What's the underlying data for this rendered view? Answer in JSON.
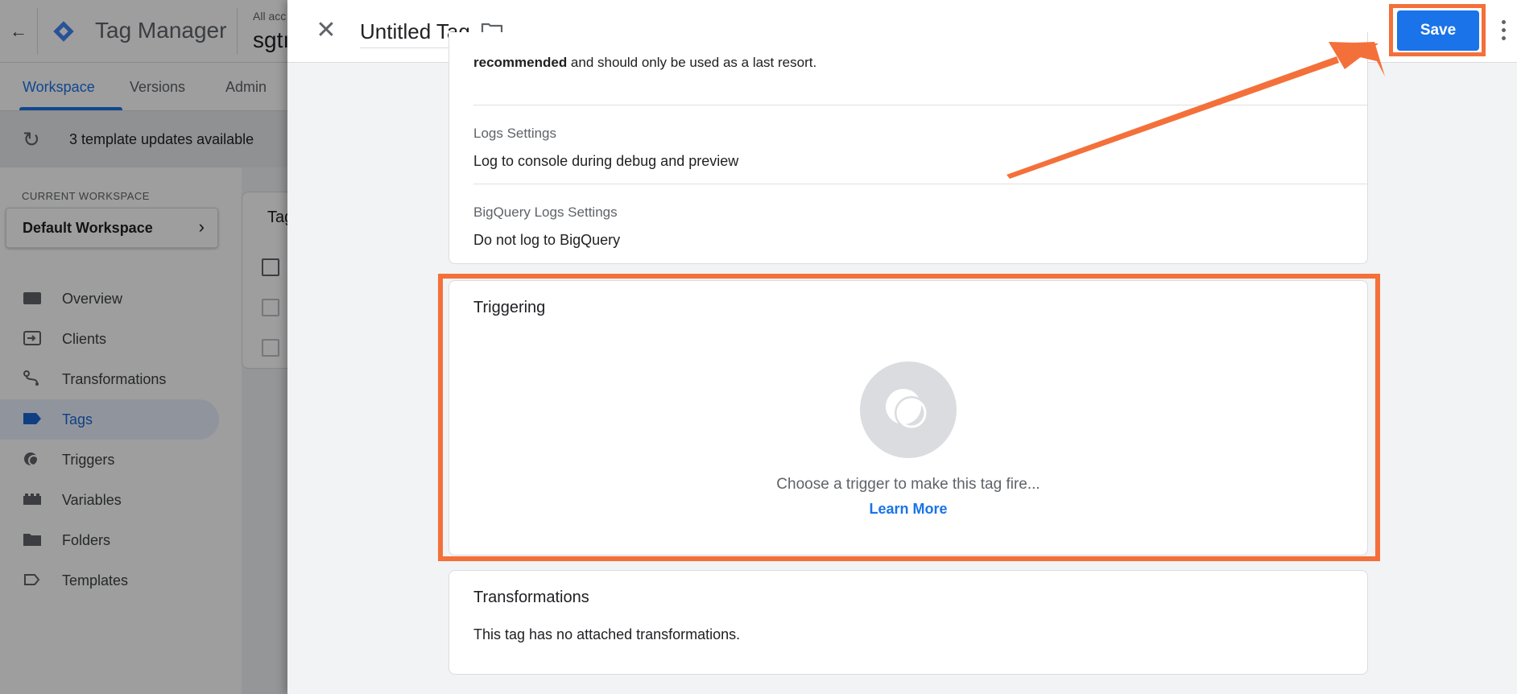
{
  "app": {
    "back_icon": "arrow-left-icon",
    "title": "Tag Manager",
    "account_label": "All acc",
    "container_name": "sgtı"
  },
  "tabs": [
    {
      "label": "Workspace",
      "active": true
    },
    {
      "label": "Versions",
      "active": false
    },
    {
      "label": "Admin",
      "active": false
    }
  ],
  "banner": {
    "icon": "history-icon",
    "text": "3 template updates available"
  },
  "workspace": {
    "label": "CURRENT WORKSPACE",
    "name": "Default Workspace"
  },
  "nav": [
    {
      "label": "Overview",
      "icon": "overview-icon",
      "active": false
    },
    {
      "label": "Clients",
      "icon": "clients-icon",
      "active": false
    },
    {
      "label": "Transformations",
      "icon": "transformations-icon",
      "active": false
    },
    {
      "label": "Tags",
      "icon": "tag-icon",
      "active": true
    },
    {
      "label": "Triggers",
      "icon": "triggers-icon",
      "active": false
    },
    {
      "label": "Variables",
      "icon": "variables-icon",
      "active": false
    },
    {
      "label": "Folders",
      "icon": "folder-icon",
      "active": false
    },
    {
      "label": "Templates",
      "icon": "templates-icon",
      "active": false
    }
  ],
  "background_card": {
    "title": "Tag"
  },
  "panel": {
    "tag_name": "Untitled Tag",
    "save_label": "Save",
    "config": {
      "recommended_bold": "recommended",
      "recommended_rest": " and should only be used as a last resort.",
      "logs_label": "Logs Settings",
      "logs_value": "Log to console during debug and preview",
      "bigquery_label": "BigQuery Logs Settings",
      "bigquery_value": "Do not log to BigQuery"
    },
    "triggering": {
      "title": "Triggering",
      "empty_text": "Choose a trigger to make this tag fire...",
      "learn_more": "Learn More"
    },
    "transformations": {
      "title": "Transformations",
      "empty_text": "This tag has no attached transformations."
    }
  },
  "colors": {
    "accent": "#1a73e8",
    "annotation": "#f4703a",
    "active_nav_bg": "#e8f0fe"
  }
}
